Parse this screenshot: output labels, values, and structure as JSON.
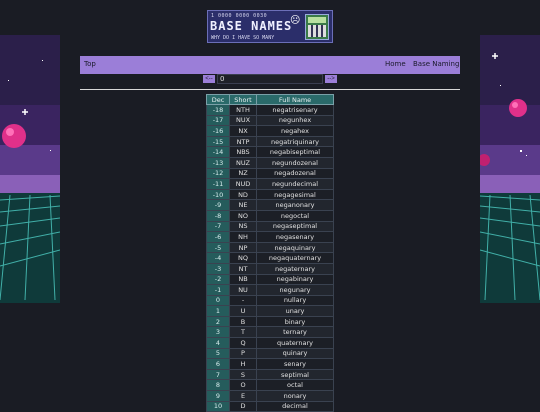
{
  "logo": {
    "line1": "1 0000 0000 0030",
    "title": "BASE NAMES",
    "line3": "WHY DO I HAVE SO MANY",
    "emoji": "☹"
  },
  "nav": {
    "top": "Top",
    "home": "Home",
    "base_naming": "Base Naming"
  },
  "controls": {
    "prev": "<--",
    "value": "0",
    "next": "-->"
  },
  "table": {
    "headers": [
      "Dec",
      "Short",
      "Full Name"
    ],
    "rows": [
      [
        "-18",
        "NTH",
        "negatrisenary"
      ],
      [
        "-17",
        "NUX",
        "negunhex"
      ],
      [
        "-16",
        "NX",
        "negahex"
      ],
      [
        "-15",
        "NTP",
        "negatriquinary"
      ],
      [
        "-14",
        "NBS",
        "negabiseptimal"
      ],
      [
        "-13",
        "NUZ",
        "negundozenal"
      ],
      [
        "-12",
        "NZ",
        "negadozenal"
      ],
      [
        "-11",
        "NUD",
        "negundecimal"
      ],
      [
        "-10",
        "ND",
        "negagesimal"
      ],
      [
        "-9",
        "NE",
        "neganonary"
      ],
      [
        "-8",
        "NO",
        "negoctal"
      ],
      [
        "-7",
        "NS",
        "negaseptimal"
      ],
      [
        "-6",
        "NH",
        "negasenary"
      ],
      [
        "-5",
        "NP",
        "negaquinary"
      ],
      [
        "-4",
        "NQ",
        "negaquaternary"
      ],
      [
        "-3",
        "NT",
        "negaternary"
      ],
      [
        "-2",
        "NB",
        "negabinary"
      ],
      [
        "-1",
        "NU",
        "negunary"
      ],
      [
        "0",
        "-",
        "nullary"
      ],
      [
        "1",
        "U",
        "unary"
      ],
      [
        "2",
        "B",
        "binary"
      ],
      [
        "3",
        "T",
        "ternary"
      ],
      [
        "4",
        "Q",
        "quaternary"
      ],
      [
        "5",
        "P",
        "quinary"
      ],
      [
        "6",
        "H",
        "senary"
      ],
      [
        "7",
        "S",
        "septimal"
      ],
      [
        "8",
        "O",
        "octal"
      ],
      [
        "9",
        "E",
        "nonary"
      ],
      [
        "10",
        "D",
        "decimal"
      ]
    ]
  },
  "colors": {
    "nav": "#9b7ed8",
    "dec_col": "#255c5c",
    "header": "#2a6a6a",
    "background": "#1a1c24"
  }
}
